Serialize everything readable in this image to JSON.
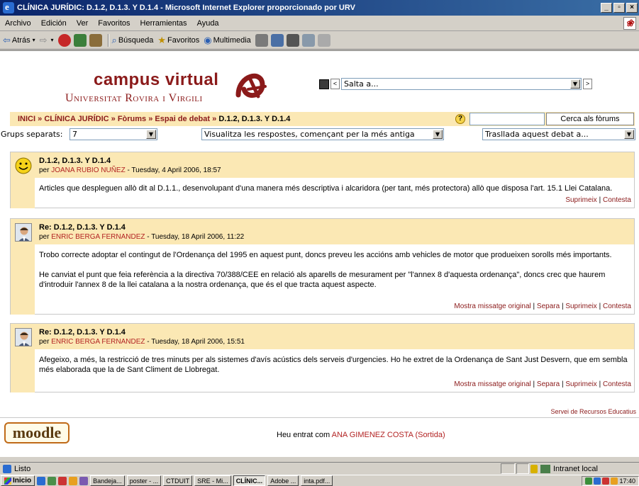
{
  "window": {
    "title": "CLÍNICA JURÍDIC: D.1.2, D.1.3. Y D.1.4 - Microsoft Internet Explorer proporcionado por URV",
    "min_label": "_",
    "max_label": "▫",
    "close_label": "×"
  },
  "menu": [
    "Archivo",
    "Edición",
    "Ver",
    "Favoritos",
    "Herramientas",
    "Ayuda"
  ],
  "toolbar": {
    "back": "Atrás",
    "search": "Búsqueda",
    "favorites": "Favoritos",
    "multimedia": "Multimedia"
  },
  "header": {
    "logo_title": "campus virtual",
    "logo_subtitle": "Universitat Rovira i Virgili",
    "jump_prev": "<",
    "jump_next": ">",
    "jump_select": "Salta a..."
  },
  "breadcrumb": {
    "items": [
      "INICI",
      "CLÍNICA JURÍDIC",
      "Fòrums",
      "Espai de debat"
    ],
    "separator": "»",
    "current": "D.1.2, D.1.3. Y D.1.4"
  },
  "search": {
    "help_label": "?",
    "input_value": "",
    "button_label": "Cerca als fòrums"
  },
  "options": {
    "groups_label": "Grups separats:",
    "groups_value": "7",
    "display_mode": "Visualitza les respostes, començant per la més antiga",
    "move_to": "Trasllada aquest debat a..."
  },
  "posts": [
    {
      "title": "D.1.2, D.1.3. Y D.1.4",
      "by": "per",
      "author": "JOANA RUBIO NUÑEZ",
      "date": " - Tuesday, 4 April 2006, 18:57",
      "paragraphs": [
        "Articles que despleguen allò dit al D.1.1., desenvolupant d'una manera més descriptiva i alcaridora (per tant, més protectora) allò que disposa l'art. 15.1 Llei Catalana."
      ],
      "links": [
        "Suprimeix",
        "Contesta"
      ]
    },
    {
      "title": "Re: D.1.2, D.1.3. Y D.1.4",
      "by": "per",
      "author": "ENRIC BERGA FERNANDEZ",
      "date": " - Tuesday, 18 April 2006, 11:22",
      "paragraphs": [
        "Trobo correcte adoptar el contingut de l'Ordenança del 1995 en aquest punt, doncs preveu les accións amb vehicles de motor que produeixen sorolls més importants.",
        "He canviat el punt que feia referència a la directiva 70/388/CEE en relació als aparells de mesurament per \"l'annex 8 d'aquesta ordenança\", doncs crec que haurem d'introduir l'annex 8 de la llei catalana a la nostra ordenança, que és el que tracta aquest aspecte."
      ],
      "links": [
        "Mostra missatge original",
        "Separa",
        "Suprimeix",
        "Contesta"
      ]
    },
    {
      "title": "Re: D.1.2, D.1.3. Y D.1.4",
      "by": "per",
      "author": "ENRIC BERGA FERNANDEZ",
      "date": " - Tuesday, 18 April 2006, 15:51",
      "paragraphs": [
        "Afegeixo, a més, la restricció de tres minuts per als sistemes d'avís acústics dels serveis d'urgencies. Ho he extret de la Ordenança de Sant Just Desvern, que em sembla més elaborada que la de Sant Climent de Llobregat."
      ],
      "links": [
        "Mostra missatge original",
        "Separa",
        "Suprimeix",
        "Contesta"
      ]
    }
  ],
  "footer": {
    "service_link": "Servei de Recursos Educatius",
    "moodle_logo": "moodle",
    "login_prefix": "Heu entrat com",
    "login_user": "ANA GIMENEZ COSTA",
    "logout": "(Sortida)"
  },
  "statusbar": {
    "status": "Listo",
    "zone": "Intranet local"
  },
  "taskbar": {
    "start": "Inicio",
    "tasks": [
      "Bandeja...",
      "poster - ...",
      "CTDUIT",
      "SRE - Mi...",
      "CLÍNIC...",
      "Adobe ...",
      "inta.pdf..."
    ],
    "active_index": 4,
    "clock": "17:40"
  }
}
